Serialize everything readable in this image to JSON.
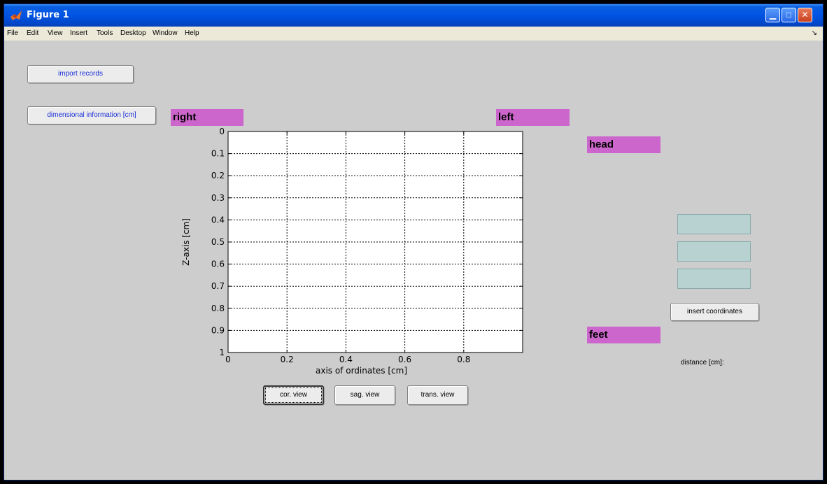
{
  "window": {
    "title": "Figure 1",
    "controls": {
      "minimize": "▁",
      "maximize": "□",
      "close": "✕"
    }
  },
  "menubar": {
    "items": [
      "File",
      "Edit",
      "View",
      "Insert",
      "Tools",
      "Desktop",
      "Window",
      "Help"
    ],
    "dock_arrow": "↘"
  },
  "buttons": {
    "import_records": "import records",
    "dimensional_information": "dimensional information [cm]",
    "insert_coordinates": "insert coordinates",
    "cor_view": "cor. view",
    "sag_view": "sag. view",
    "trans_view": "trans. view"
  },
  "orientation_labels": {
    "right": "right",
    "left": "left",
    "head": "head",
    "feet": "feet"
  },
  "coordinate_fields": [
    "",
    "",
    ""
  ],
  "distance_label": "distance [cm]:",
  "colors": {
    "label_bg": "#cc66cc",
    "field_bg": "#b8d1d1",
    "window_bg": "#cdcdcd",
    "titlebar": "#0054e3"
  },
  "chart_data": {
    "type": "scatter",
    "xlabel": "axis of ordinates [cm]",
    "ylabel": "Z-axis [cm]",
    "xlim": [
      0,
      1
    ],
    "ylim": [
      0,
      1
    ],
    "y_reversed": true,
    "x_ticks": [
      "0",
      "0.2",
      "0.4",
      "0.6",
      "0.8"
    ],
    "x_tick_values": [
      0,
      0.2,
      0.4,
      0.6,
      0.8
    ],
    "y_ticks": [
      "0",
      "0.1",
      "0.2",
      "0.3",
      "0.4",
      "0.5",
      "0.6",
      "0.7",
      "0.8",
      "0.9",
      "1"
    ],
    "y_tick_values": [
      0,
      0.1,
      0.2,
      0.3,
      0.4,
      0.5,
      0.6,
      0.7,
      0.8,
      0.9,
      1
    ],
    "grid": true,
    "grid_style": "dotted",
    "series": []
  }
}
